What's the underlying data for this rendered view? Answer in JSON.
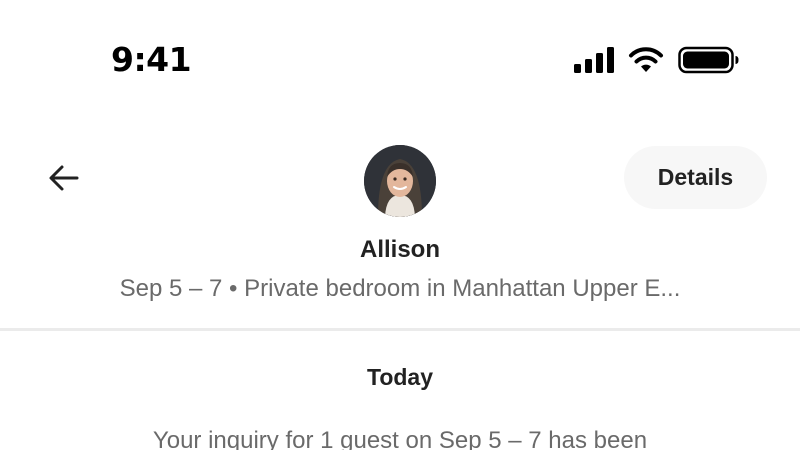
{
  "status_bar": {
    "time": "9:41",
    "icons": [
      "cellular-signal-icon",
      "wifi-icon",
      "battery-icon"
    ]
  },
  "header": {
    "back_icon": "arrow-left-icon",
    "details_label": "Details",
    "host_name": "Allison",
    "trip_summary": "Sep 5 – 7 • Private bedroom in Manhattan Upper E..."
  },
  "conversation": {
    "date_label": "Today",
    "system_message": "Your inquiry for 1 guest on Sep 5 – 7 has been"
  },
  "colors": {
    "primary_text": "#222222",
    "secondary_text": "#6a6a6a",
    "button_bg": "#f7f7f7",
    "divider": "#ebebeb"
  }
}
